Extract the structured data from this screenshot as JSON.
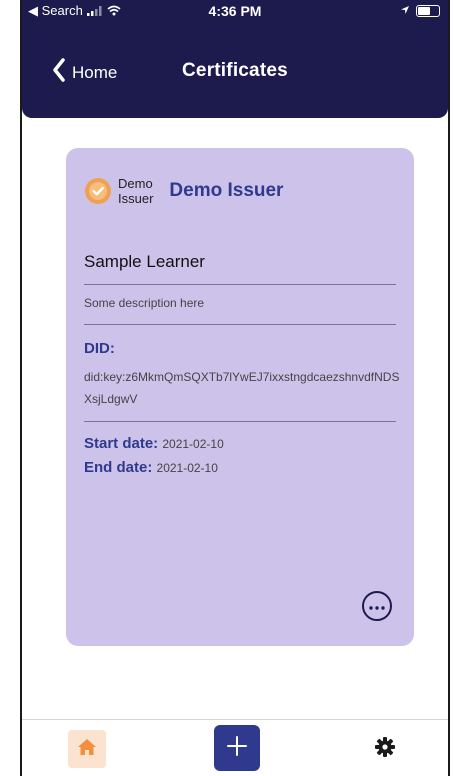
{
  "status_bar": {
    "back_app": "◀ Search",
    "time": "4:36 PM"
  },
  "nav": {
    "back_label": "Home",
    "title": "Certificates"
  },
  "certificate": {
    "issuer_logo_text": "Demo\nIssuer",
    "issuer_name": "Demo Issuer",
    "learner_name": "Sample Learner",
    "description": "Some description here",
    "did_label": "DID:",
    "did_value": "did:key:z6MkmQmSQXTb7lYwEJ7ixxstngdcaezshnvdfNDSXsjLdgwV",
    "start_label": "Start date:",
    "start_date": "2021-02-10",
    "end_label": "End date:",
    "end_date": "2021-02-10"
  },
  "colors": {
    "header_bg": "#1d1a4e",
    "card_bg": "#cdc3ea",
    "accent": "#2f3a8f",
    "home_tab_bg": "#fbe3cf",
    "badge": "#f0a050"
  },
  "icons": {
    "back": "chevron-left-icon",
    "badge": "certificate-badge-icon",
    "more": "more-icon",
    "home": "home-icon",
    "add": "plus-icon",
    "settings": "gear-icon"
  }
}
